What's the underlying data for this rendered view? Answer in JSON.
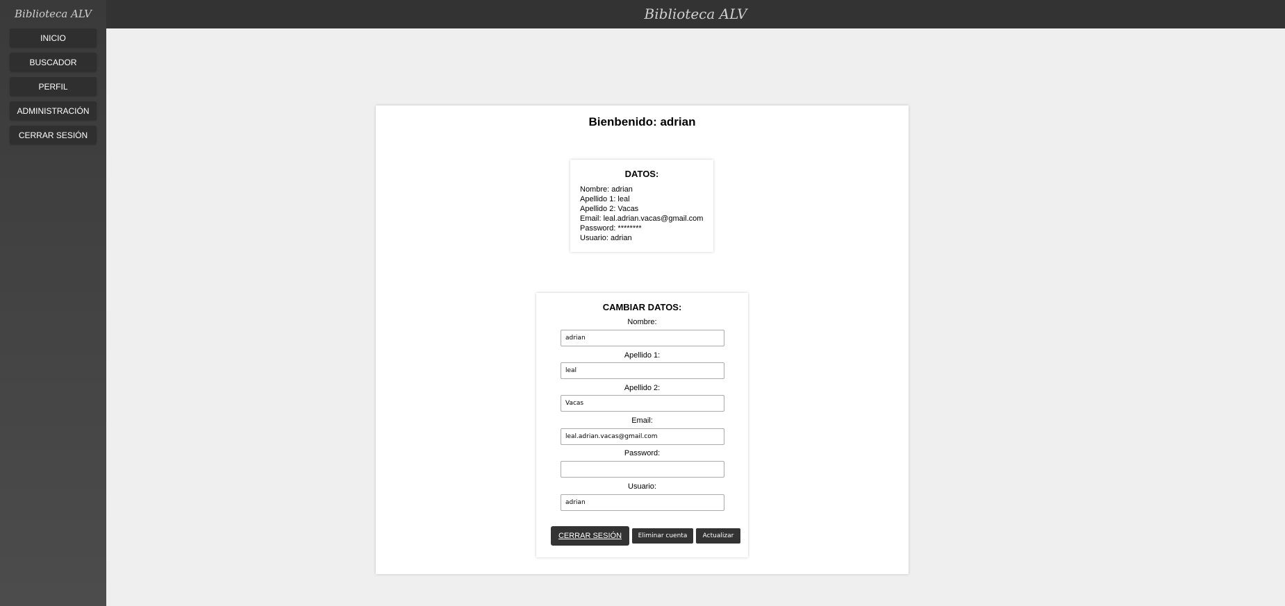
{
  "sidebar": {
    "brand": "Biblioteca ALV",
    "items": [
      {
        "label": "INICIO"
      },
      {
        "label": "BUSCADOR"
      },
      {
        "label": "PERFIL"
      },
      {
        "label": "ADMINISTRACIÓN"
      },
      {
        "label": "CERRAR SESIÓN"
      }
    ]
  },
  "header": {
    "title": "Biblioteca ALV"
  },
  "main": {
    "welcome": "Bienbenido: adrian",
    "datos": {
      "title": "DATOS:",
      "lines": [
        "Nombre: adrian",
        "Apellido 1: leal",
        "Apellido 2: Vacas",
        "Email: leal.adrian.vacas@gmail.com",
        "Password: ********",
        "Usuario: adrian"
      ]
    },
    "form": {
      "title": "CAMBIAR DATOS:",
      "fields": [
        {
          "label": "Nombre:",
          "value": "adrian"
        },
        {
          "label": "Apellido 1:",
          "value": "leal"
        },
        {
          "label": "Apellido 2:",
          "value": "Vacas"
        },
        {
          "label": "Email:",
          "value": "leal.adrian.vacas@gmail.com"
        },
        {
          "label": "Password:",
          "value": ""
        },
        {
          "label": "Usuario:",
          "value": "adrian"
        }
      ],
      "buttons": {
        "logout": "CERRAR SESIÓN",
        "delete": "Eliminar cuenta",
        "update": "Actualizar"
      }
    }
  }
}
